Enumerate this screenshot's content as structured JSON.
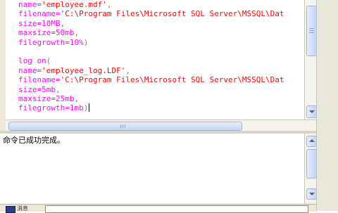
{
  "editor": {
    "lines": [
      [
        {
          "t": "name=",
          "c": "k"
        },
        {
          "t": "'employee.mdf'",
          "c": "s"
        },
        {
          "t": ",",
          "c": "p"
        }
      ],
      [
        {
          "t": "filename=",
          "c": "k"
        },
        {
          "t": "'C:\\Program Files\\Microsoft SQL Server\\MSSQL\\Dat",
          "c": "s"
        }
      ],
      [
        {
          "t": "size=10MB",
          "c": "k"
        },
        {
          "t": ",",
          "c": "p"
        }
      ],
      [
        {
          "t": "maxsize=50mb",
          "c": "k"
        },
        {
          "t": ",",
          "c": "p"
        }
      ],
      [
        {
          "t": "filegrowth=10%",
          "c": "k"
        },
        {
          "t": ")",
          "c": "p"
        }
      ],
      [],
      [
        {
          "t": "log on",
          "c": "kw"
        },
        {
          "t": "(",
          "c": "p"
        }
      ],
      [
        {
          "t": "name=",
          "c": "k"
        },
        {
          "t": "'employee_log.LDF'",
          "c": "s"
        },
        {
          "t": ",",
          "c": "p"
        }
      ],
      [
        {
          "t": "filename=",
          "c": "k"
        },
        {
          "t": "'C:\\Program Files\\Microsoft SQL Server\\MSSQL\\Dat",
          "c": "s"
        }
      ],
      [
        {
          "t": "size=5mb",
          "c": "k"
        },
        {
          "t": ",",
          "c": "p"
        }
      ],
      [
        {
          "t": "maxsize=25mb",
          "c": "k"
        },
        {
          "t": ",",
          "c": "p"
        }
      ],
      [
        {
          "t": "filegrowth=1mb",
          "c": "k"
        },
        {
          "t": ")",
          "c": "p"
        }
      ]
    ],
    "caret_line": 11
  },
  "results": {
    "message": "命令已成功完成。"
  },
  "tabs": {
    "messages_label": "消息"
  },
  "colors": {
    "keyword": "#ff00ff",
    "string": "#ff0000",
    "punctuation": "#808080"
  }
}
